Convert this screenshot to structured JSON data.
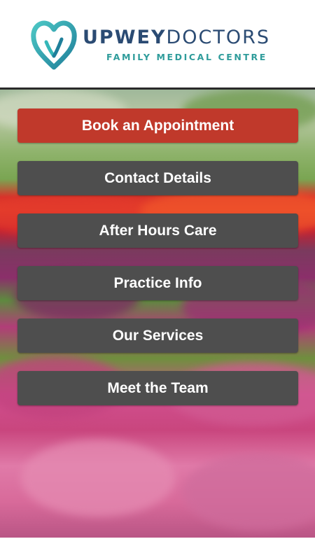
{
  "brand": {
    "name_bold": "UPWEY",
    "name_light": "DOCTORS",
    "tagline": "FAMILY MEDICAL CENTRE",
    "colors": {
      "navy": "#2b4b73",
      "teal": "#2f9c9b",
      "heart_teal": "#35b7b8"
    },
    "icon": "heart-logo-icon"
  },
  "menu": {
    "colors": {
      "primary": "#c0392b",
      "secondary": "#4e4e4e",
      "text": "#ffffff"
    },
    "items": [
      {
        "label": "Book an Appointment",
        "style": "primary"
      },
      {
        "label": "Contact Details",
        "style": "secondary"
      },
      {
        "label": "After Hours Care",
        "style": "secondary"
      },
      {
        "label": "Practice Info",
        "style": "secondary"
      },
      {
        "label": "Our Services",
        "style": "secondary"
      },
      {
        "label": "Meet the Team",
        "style": "secondary"
      }
    ]
  }
}
